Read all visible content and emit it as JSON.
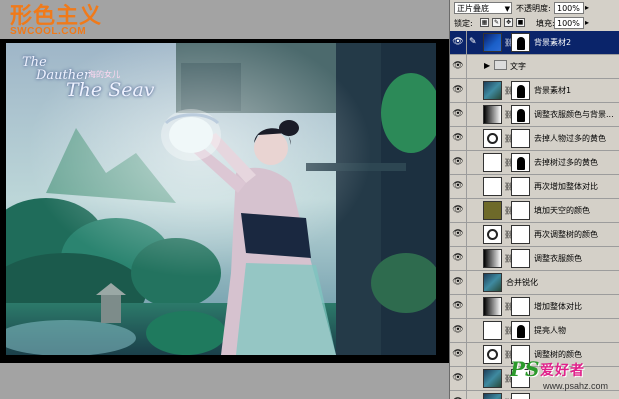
{
  "watermark_top": {
    "logo": "形色主义",
    "url": "SWCOOL.COM"
  },
  "photo": {
    "title_line1": "The",
    "title_line2": "Dauther",
    "title_line3": "The Seav",
    "subtitle": "海的女儿"
  },
  "layers_panel": {
    "blend_mode": "正片叠底",
    "opacity_label": "不透明度:",
    "opacity_value": "100%",
    "lock_label": "锁定:",
    "fill_label": "填充:",
    "fill_value": "100%",
    "layers": [
      {
        "name": "背景素材2",
        "thumb": "th-blue",
        "mask": "mask-fig",
        "selected": true,
        "icon": "paintbrush-icon"
      },
      {
        "name": "文字",
        "type": "group"
      },
      {
        "name": "背景素材1",
        "thumb": "th-photo",
        "mask": "mask-fig"
      },
      {
        "name": "调整衣服颜色与背景...",
        "thumb": "th-level",
        "mask": "mask-fig"
      },
      {
        "name": "去掉人物过多的黄色",
        "thumb": "th-hue",
        "mask": ""
      },
      {
        "name": "去掉树过多的黄色",
        "thumb": "th-sel",
        "mask": "mask-fig"
      },
      {
        "name": "再次增加整体对比",
        "thumb": "th-curve",
        "mask": ""
      },
      {
        "name": "填加天空的颜色",
        "thumb": "th-olive",
        "mask": ""
      },
      {
        "name": "再次调整树的颜色",
        "thumb": "th-hue",
        "mask": ""
      },
      {
        "name": "调整衣服颜色",
        "thumb": "th-level",
        "mask": ""
      },
      {
        "name": "合并锐化",
        "thumb": "th-photo",
        "mask": "",
        "nomask": true
      },
      {
        "name": "增加整体对比",
        "thumb": "th-level",
        "mask": ""
      },
      {
        "name": "提亮人物",
        "thumb": "th-curve",
        "mask": "mask-fig"
      },
      {
        "name": "调整树的颜色",
        "thumb": "th-hue",
        "mask": ""
      },
      {
        "name": "",
        "thumb": "th-photo",
        "mask": ""
      },
      {
        "name": "",
        "thumb": "th-photo",
        "mask": ""
      }
    ]
  },
  "watermark_bottom": {
    "ps": "PS",
    "cn": "爱好者",
    "site": "www.psahz.com"
  }
}
